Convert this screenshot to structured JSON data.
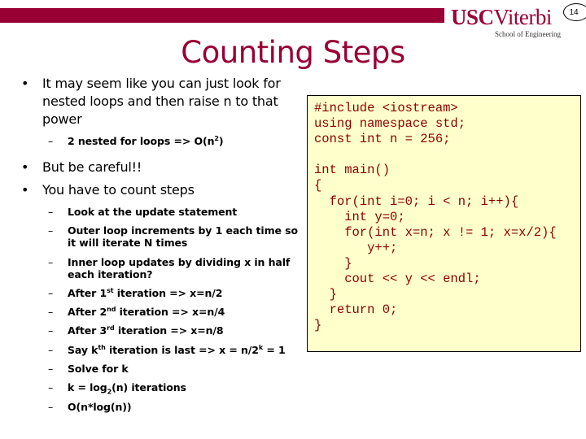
{
  "header": {
    "logo_usc": "USC",
    "logo_viterbi": "Viterbi",
    "logo_subtitle": "School of Engineering",
    "page_number": "14",
    "brand_color": "#990033"
  },
  "slide": {
    "title": "Counting Steps",
    "bullets": [
      {
        "text": "It may seem like you can just look for nested loops and then raise n to that power",
        "sub": [
          {
            "pre": "2 nested for loops => O(n",
            "sup": "2",
            "post": ")"
          }
        ]
      },
      {
        "text": "But be careful!!",
        "sub": []
      },
      {
        "text": "You have to count steps",
        "sub": [
          {
            "pre": "Look at the update statement"
          },
          {
            "pre": "Outer loop increments by 1 each time so it will iterate N times"
          },
          {
            "pre": "Inner loop updates by dividing x in half each iteration?"
          },
          {
            "pre": "After 1",
            "sup": "st",
            "post": " iteration => x=n/2"
          },
          {
            "pre": "After 2",
            "sup": "nd",
            "post": " iteration => x=n/4"
          },
          {
            "pre": "After 3",
            "sup": "rd",
            "post": " iteration => x=n/8"
          },
          {
            "pre": "Say k",
            "sup": "th",
            "post": " iteration is last => x = n/2",
            "sup2": "k",
            "post2": " = 1"
          },
          {
            "pre": "Solve for k"
          },
          {
            "pre": "k = log",
            "sub": "2",
            "post": "(n) iterations"
          },
          {
            "pre": "O(n*log(n))"
          }
        ]
      }
    ],
    "bullet_glyph": "•",
    "dash_glyph": "–"
  },
  "code": {
    "background": "#ffffcc",
    "text_color": "#8b0000",
    "lines": [
      "#include <iostream>",
      "using namespace std;",
      "const int n = 256;",
      "",
      "int main()",
      "{",
      "  for(int i=0; i < n; i++){",
      "    int y=0;",
      "    for(int x=n; x != 1; x=x/2){",
      "       y++;",
      "    }",
      "    cout << y << endl;",
      "  }",
      "  return 0;",
      "}"
    ]
  }
}
